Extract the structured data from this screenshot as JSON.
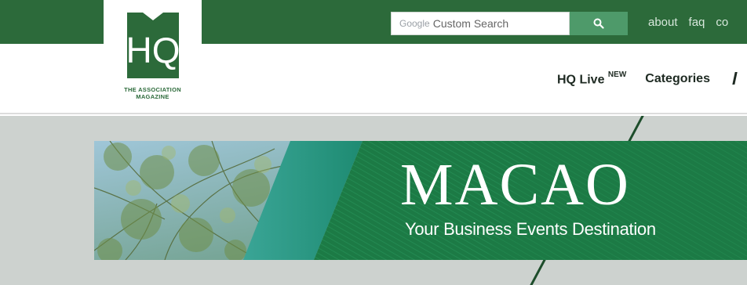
{
  "header": {
    "search": {
      "brand": "Google",
      "placeholder": "Custom Search"
    },
    "links": [
      "about",
      "faq",
      "co"
    ]
  },
  "logo": {
    "mark": "HQ",
    "line1": "THE ASSOCIATION",
    "line2": "MAGAZINE"
  },
  "nav": {
    "items": [
      {
        "label": "HQ Live",
        "badge": "NEW"
      },
      {
        "label": "Categories"
      }
    ]
  },
  "banner": {
    "title": "MACAO",
    "subtitle": "Your Business Events Destination"
  },
  "colors": {
    "brand_green": "#2c6a3a",
    "search_button": "#4e9a6a",
    "content_bg": "#cdd2cf",
    "banner_green": "#1c7a45"
  },
  "icons": {
    "search_button": "search-icon"
  }
}
